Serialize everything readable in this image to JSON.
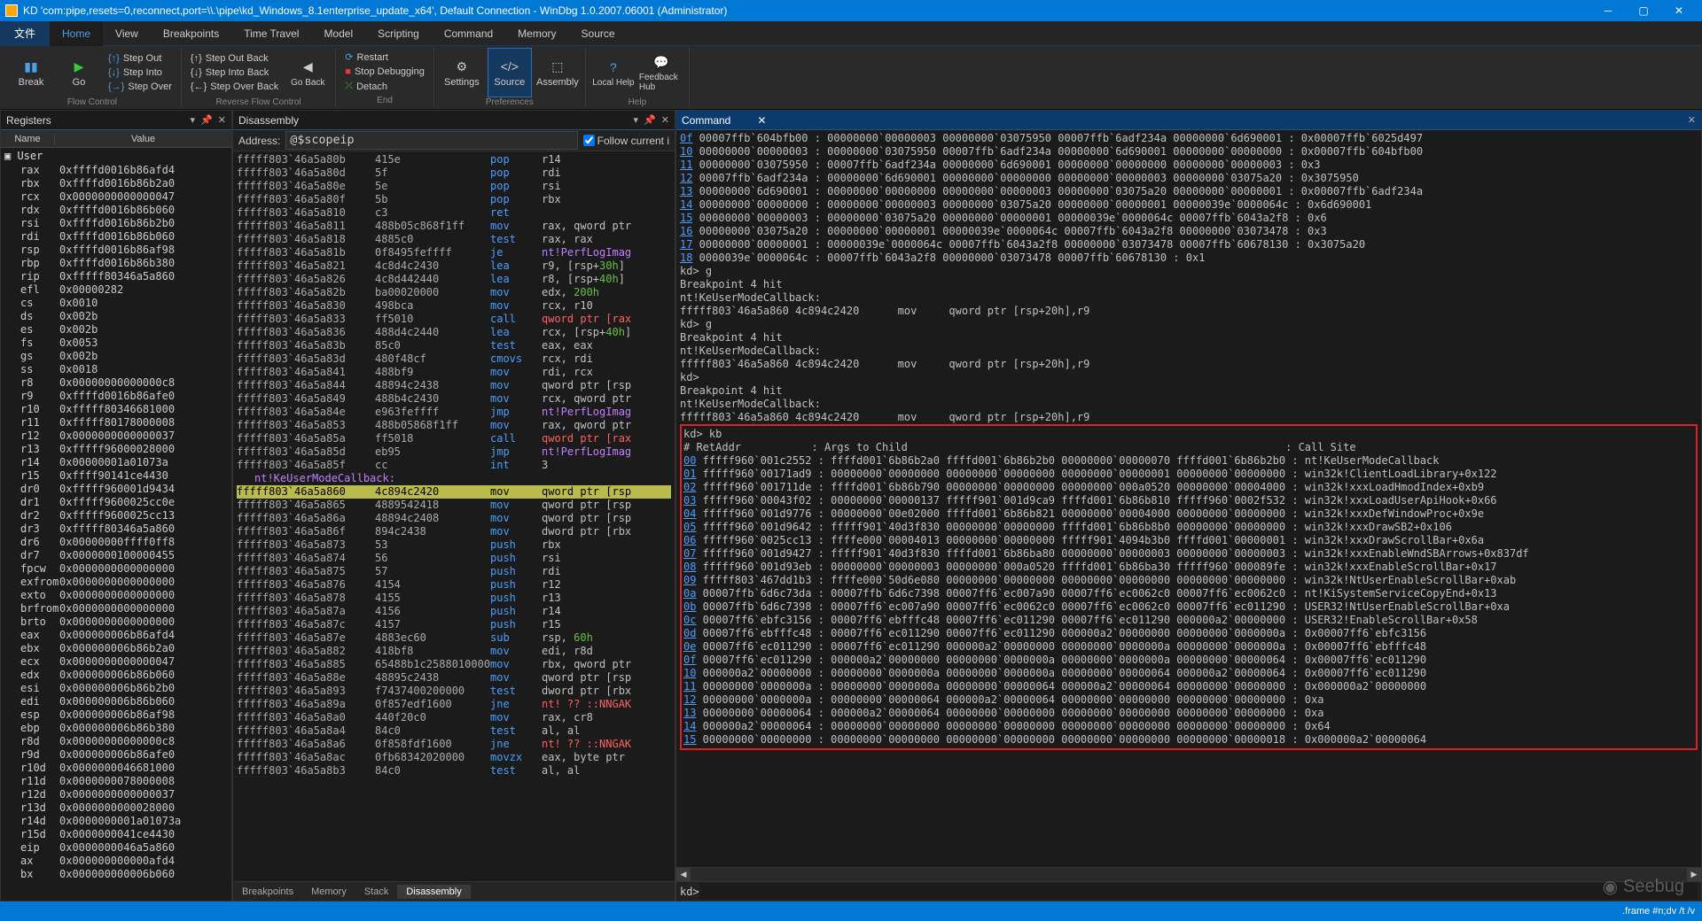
{
  "title": "KD 'com:pipe,resets=0,reconnect,port=\\\\.\\pipe\\kd_Windows_8.1enterprise_update_x64', Default Connection  -  WinDbg 1.0.2007.06001 (Administrator)",
  "menubar": {
    "file": "文件",
    "tabs": [
      "Home",
      "View",
      "Breakpoints",
      "Time Travel",
      "Model",
      "Scripting",
      "Command",
      "Memory",
      "Source"
    ]
  },
  "ribbon": {
    "break": "Break",
    "go": "Go",
    "stepout": "Step Out",
    "stepinto": "Step Into",
    "stepover": "Step Over",
    "flow": "Flow Control",
    "stepoutback": "Step Out Back",
    "stepintoback": "Step Into Back",
    "stepoverback": "Step Over Back",
    "goback": "Go Back",
    "reverse": "Reverse Flow Control",
    "restart": "Restart",
    "stopdbg": "Stop Debugging",
    "detach": "Detach",
    "end": "End",
    "settings": "Settings",
    "source": "Source",
    "assembly": "Assembly",
    "prefs": "Preferences",
    "localhelp": "Local Help",
    "feedback": "Feedback Hub",
    "help": "Help"
  },
  "panels": {
    "registers": {
      "title": "Registers",
      "col1": "Name",
      "col2": "Value",
      "usergrp": "User"
    },
    "disassembly": {
      "title": "Disassembly",
      "addrLabel": "Address:",
      "addrValue": "@$scopeip",
      "follow": "Follow current i"
    },
    "command": {
      "title": "Command",
      "prompt": "kd>"
    },
    "tabstrip": [
      "Breakpoints",
      "Memory",
      "Stack",
      "Disassembly"
    ]
  },
  "status": {
    "right": ".frame #n;dv /t /v"
  },
  "registers": [
    [
      "rax",
      "0xffffd0016b86afd4"
    ],
    [
      "rbx",
      "0xffffd0016b86b2a0"
    ],
    [
      "rcx",
      "0x0000000000000047"
    ],
    [
      "rdx",
      "0xffffd0016b86b060"
    ],
    [
      "rsi",
      "0xffffd0016b86b2b0"
    ],
    [
      "rdi",
      "0xffffd0016b86b060"
    ],
    [
      "rsp",
      "0xffffd0016b86af98"
    ],
    [
      "rbp",
      "0xffffd0016b86b380"
    ],
    [
      "rip",
      "0xfffff80346a5a860"
    ],
    [
      "efl",
      "0x00000282"
    ],
    [
      "cs",
      "0x0010"
    ],
    [
      "ds",
      "0x002b"
    ],
    [
      "es",
      "0x002b"
    ],
    [
      "fs",
      "0x0053"
    ],
    [
      "gs",
      "0x002b"
    ],
    [
      "ss",
      "0x0018"
    ],
    [
      "r8",
      "0x00000000000000c8"
    ],
    [
      "r9",
      "0xffffd0016b86afe0"
    ],
    [
      "r10",
      "0xfffff80346681000"
    ],
    [
      "r11",
      "0xfffff80178000008"
    ],
    [
      "r12",
      "0x0000000000000037"
    ],
    [
      "r13",
      "0xfffff96000028000"
    ],
    [
      "r14",
      "0x00000001a01073a"
    ],
    [
      "r15",
      "0xffff90141ce4430"
    ],
    [
      "dr0",
      "0xfffff960001d9434"
    ],
    [
      "dr1",
      "0xfffff9600025cc0e"
    ],
    [
      "dr2",
      "0xfffff9600025cc13"
    ],
    [
      "dr3",
      "0xfffff80346a5a860"
    ],
    [
      "dr6",
      "0x00000000ffff0ff8"
    ],
    [
      "dr7",
      "0x0000000100000455"
    ],
    [
      "fpcw",
      "0x0000000000000000"
    ],
    [
      "exfrom",
      "0x0000000000000000"
    ],
    [
      "exto",
      "0x0000000000000000"
    ],
    [
      "brfrom",
      "0x0000000000000000"
    ],
    [
      "brto",
      "0x0000000000000000"
    ],
    [
      "eax",
      "0x000000006b86afd4"
    ],
    [
      "ebx",
      "0x000000006b86b2a0"
    ],
    [
      "ecx",
      "0x0000000000000047"
    ],
    [
      "edx",
      "0x000000006b86b060"
    ],
    [
      "esi",
      "0x000000006b86b2b0"
    ],
    [
      "edi",
      "0x000000006b86b060"
    ],
    [
      "esp",
      "0x000000006b86af98"
    ],
    [
      "ebp",
      "0x000000006b86b380"
    ],
    [
      "r8d",
      "0x00000000000000c8"
    ],
    [
      "r9d",
      "0x000000006b86afe0"
    ],
    [
      "r10d",
      "0x0000000046681000"
    ],
    [
      "r11d",
      "0x0000000078000008"
    ],
    [
      "r12d",
      "0x0000000000000037"
    ],
    [
      "r13d",
      "0x0000000000028000"
    ],
    [
      "r14d",
      "0x0000000001a01073a"
    ],
    [
      "r15d",
      "0x0000000041ce4430"
    ],
    [
      "eip",
      "0x0000000046a5a860"
    ],
    [
      "ax",
      "0x000000000000afd4"
    ],
    [
      "bx",
      "0x000000000006b060"
    ]
  ],
  "disassembly_header": "nt!KeUserModeCallback:",
  "disassembly": [
    [
      "fffff803`46a5a80b",
      "415e",
      "pop",
      "r14",
      ""
    ],
    [
      "fffff803`46a5a80d",
      "5f",
      "pop",
      "rdi",
      ""
    ],
    [
      "fffff803`46a5a80e",
      "5e",
      "pop",
      "rsi",
      ""
    ],
    [
      "fffff803`46a5a80f",
      "5b",
      "pop",
      "rbx",
      ""
    ],
    [
      "fffff803`46a5a810",
      "c3",
      "ret",
      "",
      "red"
    ],
    [
      "fffff803`46a5a811",
      "488b05c868f1ff",
      "mov",
      "rax, qword ptr",
      ""
    ],
    [
      "fffff803`46a5a818",
      "4885c0",
      "test",
      "rax, rax",
      ""
    ],
    [
      "fffff803`46a5a81b",
      "0f8495feffff",
      "je",
      "nt!PerfLogImag",
      "purple"
    ],
    [
      "fffff803`46a5a821",
      "4c8d4c2430",
      "lea",
      "r9, [rsp+<span class='green'>30h</span>]",
      ""
    ],
    [
      "fffff803`46a5a826",
      "4c8d442440",
      "lea",
      "r8, [rsp+<span class='green'>40h</span>]",
      ""
    ],
    [
      "fffff803`46a5a82b",
      "ba00020000",
      "mov",
      "edx, <span class='green'>200h</span>",
      ""
    ],
    [
      "fffff803`46a5a830",
      "498bca",
      "mov",
      "rcx, r10",
      ""
    ],
    [
      "fffff803`46a5a833",
      "ff5010",
      "call",
      "qword ptr [rax",
      "red"
    ],
    [
      "fffff803`46a5a836",
      "488d4c2440",
      "lea",
      "rcx, [rsp+<span class='green'>40h</span>]",
      ""
    ],
    [
      "fffff803`46a5a83b",
      "85c0",
      "test",
      "eax, eax",
      ""
    ],
    [
      "fffff803`46a5a83d",
      "480f48cf",
      "cmovs",
      "rcx, rdi",
      ""
    ],
    [
      "fffff803`46a5a841",
      "488bf9",
      "mov",
      "rdi, rcx",
      ""
    ],
    [
      "fffff803`46a5a844",
      "48894c2438",
      "mov",
      "qword ptr [rsp",
      ""
    ],
    [
      "fffff803`46a5a849",
      "488b4c2430",
      "mov",
      "rcx, qword ptr",
      ""
    ],
    [
      "fffff803`46a5a84e",
      "e963feffff",
      "jmp",
      "nt!PerfLogImag",
      "purple"
    ],
    [
      "fffff803`46a5a853",
      "488b05868f1ff",
      "mov",
      "rax, qword ptr",
      ""
    ],
    [
      "fffff803`46a5a85a",
      "ff5018",
      "call",
      "qword ptr [rax",
      "red"
    ],
    [
      "fffff803`46a5a85d",
      "eb95",
      "jmp",
      "nt!PerfLogImag",
      "purple"
    ],
    [
      "fffff803`46a5a85f",
      "cc",
      "int",
      "3",
      ""
    ]
  ],
  "disassembly_hl": [
    "fffff803`46a5a860",
    "4c894c2420",
    "mov",
    "qword ptr [rsp"
  ],
  "disassembly_after": [
    [
      "fffff803`46a5a865",
      "4889542418",
      "mov",
      "qword ptr [rsp",
      ""
    ],
    [
      "fffff803`46a5a86a",
      "48894c2408",
      "mov",
      "qword ptr [rsp",
      ""
    ],
    [
      "fffff803`46a5a86f",
      "894c2438",
      "mov",
      "dword ptr [rbx",
      ""
    ],
    [
      "fffff803`46a5a873",
      "53",
      "push",
      "rbx",
      ""
    ],
    [
      "fffff803`46a5a874",
      "56",
      "push",
      "rsi",
      ""
    ],
    [
      "fffff803`46a5a875",
      "57",
      "push",
      "rdi",
      ""
    ],
    [
      "fffff803`46a5a876",
      "4154",
      "push",
      "r12",
      ""
    ],
    [
      "fffff803`46a5a878",
      "4155",
      "push",
      "r13",
      ""
    ],
    [
      "fffff803`46a5a87a",
      "4156",
      "push",
      "r14",
      ""
    ],
    [
      "fffff803`46a5a87c",
      "4157",
      "push",
      "r15",
      ""
    ],
    [
      "fffff803`46a5a87e",
      "4883ec60",
      "sub",
      "rsp, <span class='green'>60h</span>",
      ""
    ],
    [
      "fffff803`46a5a882",
      "418bf8",
      "mov",
      "edi, r8d",
      ""
    ],
    [
      "fffff803`46a5a885",
      "65488b1c2588010000",
      "mov",
      "rbx, qword ptr",
      ""
    ],
    [
      "fffff803`46a5a88e",
      "48895c2438",
      "mov",
      "qword ptr [rsp",
      ""
    ],
    [
      "fffff803`46a5a893",
      "f7437400200000",
      "test",
      "dword ptr [rbx",
      ""
    ],
    [
      "fffff803`46a5a89a",
      "0f857edf1600",
      "jne",
      "nt! ?? ::NNGAK",
      "red"
    ],
    [
      "fffff803`46a5a8a0",
      "440f20c0",
      "mov",
      "rax, cr8",
      ""
    ],
    [
      "fffff803`46a5a8a4",
      "84c0",
      "test",
      "al, al",
      ""
    ],
    [
      "fffff803`46a5a8a6",
      "0f858fdf1600",
      "jne",
      "nt! ?? ::NNGAK",
      "red"
    ],
    [
      "fffff803`46a5a8ac",
      "0fb68342020000",
      "movzx",
      "eax, byte ptr",
      ""
    ],
    [
      "fffff803`46a5a8b3",
      "84c0",
      "test",
      "al, al",
      ""
    ]
  ],
  "cmd_top": [
    [
      "0f",
      "00007ffb`604bfb00 : 00000000`00000003 00000000`03075950 00007ffb`6adf234a 00000000`6d690001 : 0x00007ffb`6025d497"
    ],
    [
      "10",
      "00000000`00000003 : 00000000`03075950 00007ffb`6adf234a 00000000`6d690001 00000000`00000000 : 0x00007ffb`604bfb00"
    ],
    [
      "11",
      "00000000`03075950 : 00007ffb`6adf234a 00000000`6d690001 00000000`00000000 00000000`00000003 : 0x3"
    ],
    [
      "12",
      "00007ffb`6adf234a : 00000000`6d690001 00000000`00000000 00000000`00000003 00000000`03075a20 : 0x3075950"
    ],
    [
      "13",
      "00000000`6d690001 : 00000000`00000000 00000000`00000003 00000000`03075a20 00000000`00000001 : 0x00007ffb`6adf234a"
    ],
    [
      "14",
      "00000000`00000000 : 00000000`00000003 00000000`03075a20 00000000`00000001 00000039e`0000064c : 0x6d690001"
    ],
    [
      "15",
      "00000000`00000003 : 00000000`03075a20 00000000`00000001 00000039e`0000064c 00007ffb`6043a2f8 : 0x6"
    ],
    [
      "16",
      "00000000`03075a20 : 00000000`00000001 00000039e`0000064c 00007ffb`6043a2f8 00000000`03073478 : 0x3"
    ],
    [
      "17",
      "00000000`00000001 : 00000039e`0000064c 00007ffb`6043a2f8 00000000`03073478 00007ffb`60678130 : 0x3075a20"
    ],
    [
      "18",
      "0000039e`0000064c : 00007ffb`6043a2f8 00000000`03073478 00007ffb`60678130 : 0x1"
    ]
  ],
  "cmd_breaks": [
    "kd> g",
    "Breakpoint 4 hit",
    "nt!KeUserModeCallback:",
    "fffff803`46a5a860 4c894c2420      mov     qword ptr [rsp+20h],r9",
    "kd> g",
    "Breakpoint 4 hit",
    "nt!KeUserModeCallback:",
    "fffff803`46a5a860 4c894c2420      mov     qword ptr [rsp+20h],r9",
    "kd>",
    "Breakpoint 4 hit",
    "nt!KeUserModeCallback:",
    "fffff803`46a5a860 4c894c2420      mov     qword ptr [rsp+20h],r9"
  ],
  "cmd_kb_header": [
    "kd> kb",
    "# RetAddr           : Args to Child                                                           : Call Site"
  ],
  "cmd_kb": [
    [
      "00",
      "fffff960`001c2552 : ffffd001`6b86b2a0 ffffd001`6b86b2b0 00000000`00000070 ffffd001`6b86b2b0 : nt!KeUserModeCallback"
    ],
    [
      "01",
      "fffff960`00171ad9 : 00000000`00000000 00000000`00000000 00000000`00000001 00000000`00000000 : win32k!ClientLoadLibrary+0x122"
    ],
    [
      "02",
      "fffff960`001711de : ffffd001`6b86b790 00000000`00000000 00000000`000a0520 00000000`00004000 : win32k!xxxLoadHmodIndex+0xb9"
    ],
    [
      "03",
      "fffff960`00043f02 : 00000000`00000137 fffff901`001d9ca9 ffffd001`6b86b810 fffff960`0002f532 : win32k!xxxLoadUserApiHook+0x66"
    ],
    [
      "04",
      "fffff960`001d9776 : 00000000`00e02000 ffffd001`6b86b821 00000000`00004000 00000000`00000000 : win32k!xxxDefWindowProc+0x9e"
    ],
    [
      "05",
      "fffff960`001d9642 : fffff901`40d3f830 00000000`00000000 ffffd001`6b86b8b0 00000000`00000000 : win32k!xxxDrawSB2+0x106"
    ],
    [
      "06",
      "fffff960`0025cc13 : ffffe000`00004013 00000000`00000000 fffff901`4094b3b0 ffffd001`00000001 : win32k!xxxDrawScrollBar+0x6a"
    ],
    [
      "07",
      "fffff960`001d9427 : fffff901`40d3f830 ffffd001`6b86ba80 00000000`00000003 00000000`00000003 : win32k!xxxEnableWndSBArrows+0x837df"
    ],
    [
      "08",
      "fffff960`001d93eb : 00000000`00000003 00000000`000a0520 ffffd001`6b86ba30 fffff960`000089fe : win32k!xxxEnableScrollBar+0x17"
    ],
    [
      "09",
      "fffff803`467dd1b3 : ffffe000`50d6e080 00000000`00000000 00000000`00000000 00000000`00000000 : win32k!NtUserEnableScrollBar+0xab"
    ],
    [
      "0a",
      "00007ffb`6d6c73da : 00007ffb`6d6c7398 00007ff6`ec007a90 00007ff6`ec0062c0 00007ff6`ec0062c0 : nt!KiSystemServiceCopyEnd+0x13"
    ],
    [
      "0b",
      "00007ffb`6d6c7398 : 00007ff6`ec007a90 00007ff6`ec0062c0 00007ff6`ec0062c0 00007ff6`ec011290 : USER32!NtUserEnableScrollBar+0xa"
    ],
    [
      "0c",
      "00007ff6`ebfc3156 : 00007ff6`ebfffc48 00007ff6`ec011290 00007ff6`ec011290 000000a2`00000000 : USER32!EnableScrollBar+0x58"
    ],
    [
      "0d",
      "00007ff6`ebfffc48 : 00007ff6`ec011290 00007ff6`ec011290 000000a2`00000000 00000000`0000000a : 0x00007ff6`ebfc3156"
    ],
    [
      "0e",
      "00007ff6`ec011290 : 00007ff6`ec011290 000000a2`00000000 00000000`0000000a 00000000`0000000a : 0x00007ff6`ebfffc48"
    ],
    [
      "0f",
      "00007ff6`ec011290 : 000000a2`00000000 00000000`0000000a 00000000`0000000a 00000000`00000064 : 0x00007ff6`ec011290"
    ],
    [
      "10",
      "000000a2`00000000 : 00000000`0000000a 00000000`0000000a 00000000`00000064 000000a2`00000064 : 0x00007ff6`ec011290"
    ],
    [
      "11",
      "00000000`0000000a : 00000000`0000000a 00000000`00000064 000000a2`00000064 00000000`00000000 : 0x000000a2`00000000"
    ],
    [
      "12",
      "00000000`0000000a : 00000000`00000064 000000a2`00000064 00000000`00000000 00000000`00000000 : 0xa"
    ],
    [
      "13",
      "00000000`00000064 : 000000a2`00000064 00000000`00000000 00000000`00000000 00000000`00000000 : 0xa"
    ],
    [
      "14",
      "000000a2`00000064 : 00000000`00000000 00000000`00000000 00000000`00000000 00000000`00000000 : 0x64"
    ],
    [
      "15",
      "00000000`00000000 : 00000000`00000000 00000000`00000000 00000000`00000000 00000000`00000018 : 0x000000a2`00000064"
    ]
  ],
  "seebug": "Seebug"
}
